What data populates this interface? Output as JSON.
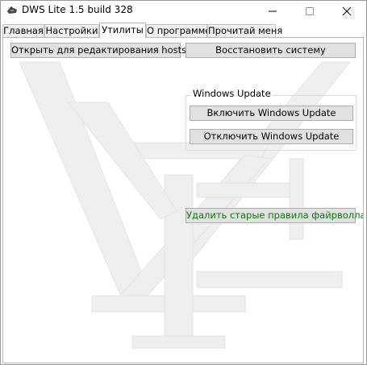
{
  "window": {
    "title": "DWS Lite 1.5 build 328"
  },
  "tabs": [
    {
      "label": "Главная",
      "active": false
    },
    {
      "label": "Настройки",
      "active": false
    },
    {
      "label": "Утилиты",
      "active": true
    },
    {
      "label": "О программе",
      "active": false
    },
    {
      "label": "Прочитай меня",
      "active": false
    }
  ],
  "utilities": {
    "open_hosts_label": "Открыть для редактирования hosts",
    "restore_system_label": "Восстановить систему",
    "windows_update_group": {
      "title": "Windows Update",
      "enable_label": "Включить Windows Update",
      "disable_label": "Отключить Windows Update"
    },
    "delete_firewall_rules_label": "Удалить старые правила файрволла"
  },
  "colors": {
    "green_text": "#0a7a0a",
    "button_face": "#e1e1e1",
    "watermark": "#efefef"
  },
  "icons": {
    "app": "dws-app-icon",
    "minimize": "minimize-icon",
    "maximize": "maximize-icon",
    "close": "close-icon"
  }
}
